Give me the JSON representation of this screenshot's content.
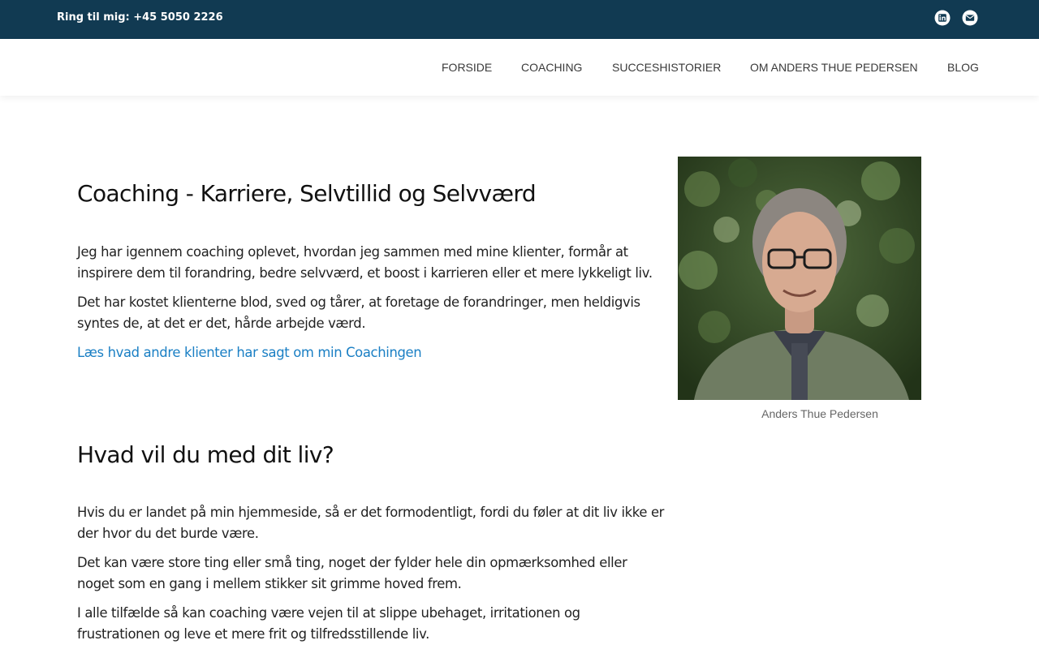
{
  "topbar": {
    "phone": "Ring til mig: +45 5050 2226",
    "icons": [
      "linkedin-icon",
      "envelope-icon"
    ],
    "background": "#113a52"
  },
  "nav": {
    "items": [
      {
        "label": "FORSIDE"
      },
      {
        "label": "COACHING"
      },
      {
        "label": "SUCCESHISTORIER"
      },
      {
        "label": "OM ANDERS THUE PEDERSEN"
      },
      {
        "label": "BLOG"
      }
    ]
  },
  "main": {
    "heading1": "Coaching - Karriere, Selvtillid og Selvværd",
    "para1": "Jeg har igennem coaching oplevet, hvordan jeg sammen med mine klienter, formår at inspirere dem til forandring, bedre selvværd, et boost i karrieren eller et mere lykkeligt liv.",
    "para2": "Det har kostet klienterne blod, sved og tårer, at foretage de forandringer, men heldigvis syntes de, at det er det, hårde arbejde værd.",
    "link1": "Læs hvad andre klienter har sagt om min Coachingen",
    "heading2": "Hvad vil du med dit liv?",
    "para3": "Hvis du er landet på min hjemmeside, så er det formodentligt, fordi du føler at dit liv ikke er der hvor du det burde være.",
    "para4": "Det kan være store ting eller små ting, noget der fylder hele din opmærksomhed eller noget som en gang i mellem stikker sit grimme hoved frem.",
    "para5": "I alle tilfælde så kan coaching være vejen til at slippe ubehaget, irritationen og frustrationen og leve et mere frit og tilfredsstillende liv."
  },
  "sidebar": {
    "caption": "Anders Thue Pedersen"
  },
  "colors": {
    "link": "#1a7fc4",
    "heading": "#111111",
    "text": "#222222"
  }
}
